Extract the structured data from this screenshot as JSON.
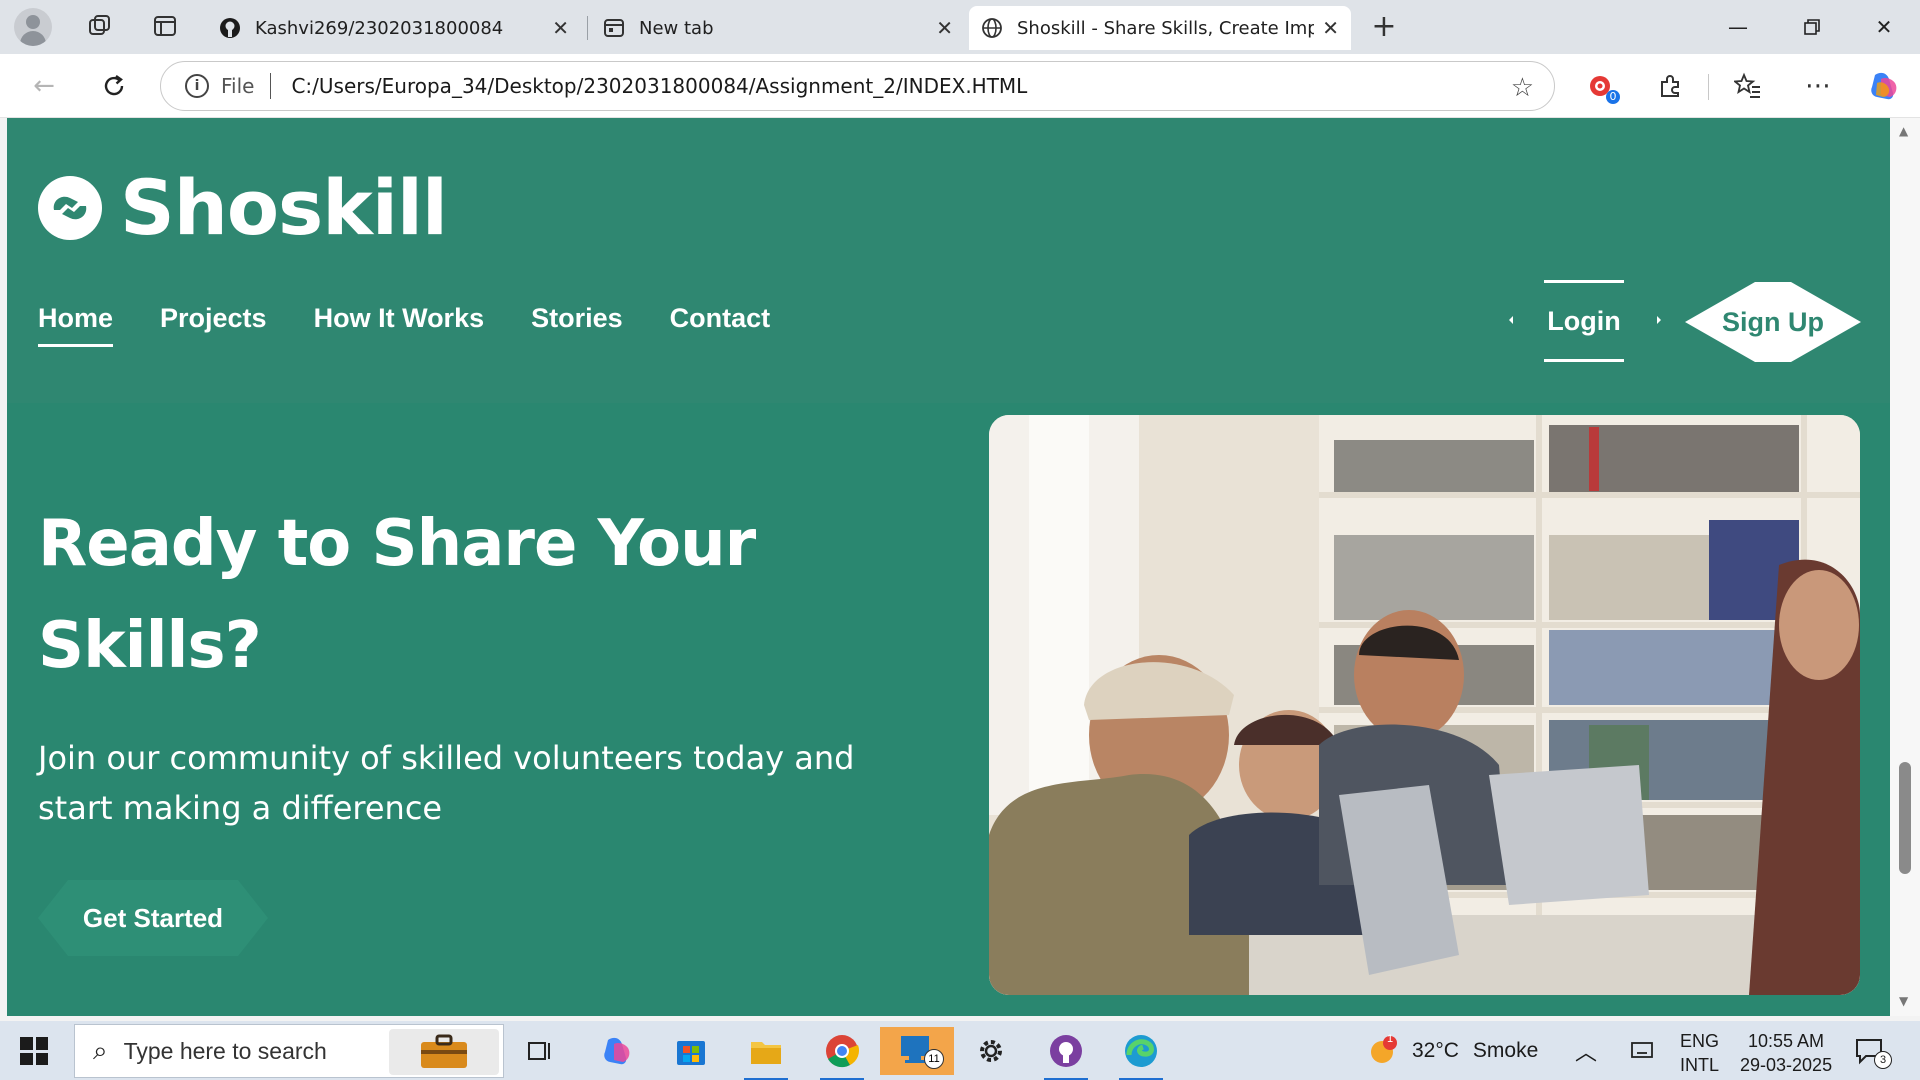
{
  "browser": {
    "tabs": [
      {
        "title": "Kashvi269/2302031800084",
        "icon": "github-icon",
        "active": false
      },
      {
        "title": "New tab",
        "icon": "newtab-icon",
        "active": false
      },
      {
        "title": "Shoskill - Share Skills, Create Imp",
        "icon": "globe-icon",
        "active": true
      }
    ],
    "new_tab_label": "+",
    "address": {
      "scheme": "File",
      "url": "C:/Users/Europa_34/Desktop/2302031800084/Assignment_2/INDEX.HTML"
    },
    "extension_badge": "0"
  },
  "site": {
    "logo_text": "Shoskill",
    "nav": [
      {
        "label": "Home",
        "current": true
      },
      {
        "label": "Projects",
        "current": false
      },
      {
        "label": "How It Works",
        "current": false
      },
      {
        "label": "Stories",
        "current": false
      },
      {
        "label": "Contact",
        "current": false
      }
    ],
    "login_label": "Login",
    "signup_label": "Sign Up",
    "hero": {
      "heading_line1": "Ready to Share Your",
      "heading_line2": "Skills?",
      "subtitle": "Join our community of skilled volunteers today and start making a difference",
      "cta_label": "Get Started"
    },
    "colors": {
      "primary": "#2a8770",
      "header": "#2f8771",
      "text": "#ffffff"
    }
  },
  "taskbar": {
    "search_placeholder": "Type here to search",
    "weather": {
      "temp": "32°C",
      "condition": "Smoke",
      "badge": "1"
    },
    "language": {
      "line1": "ENG",
      "line2": "INTL"
    },
    "clock": {
      "time": "10:55 AM",
      "date": "29-03-2025"
    },
    "notification_count": "3",
    "app_badge": "11"
  }
}
